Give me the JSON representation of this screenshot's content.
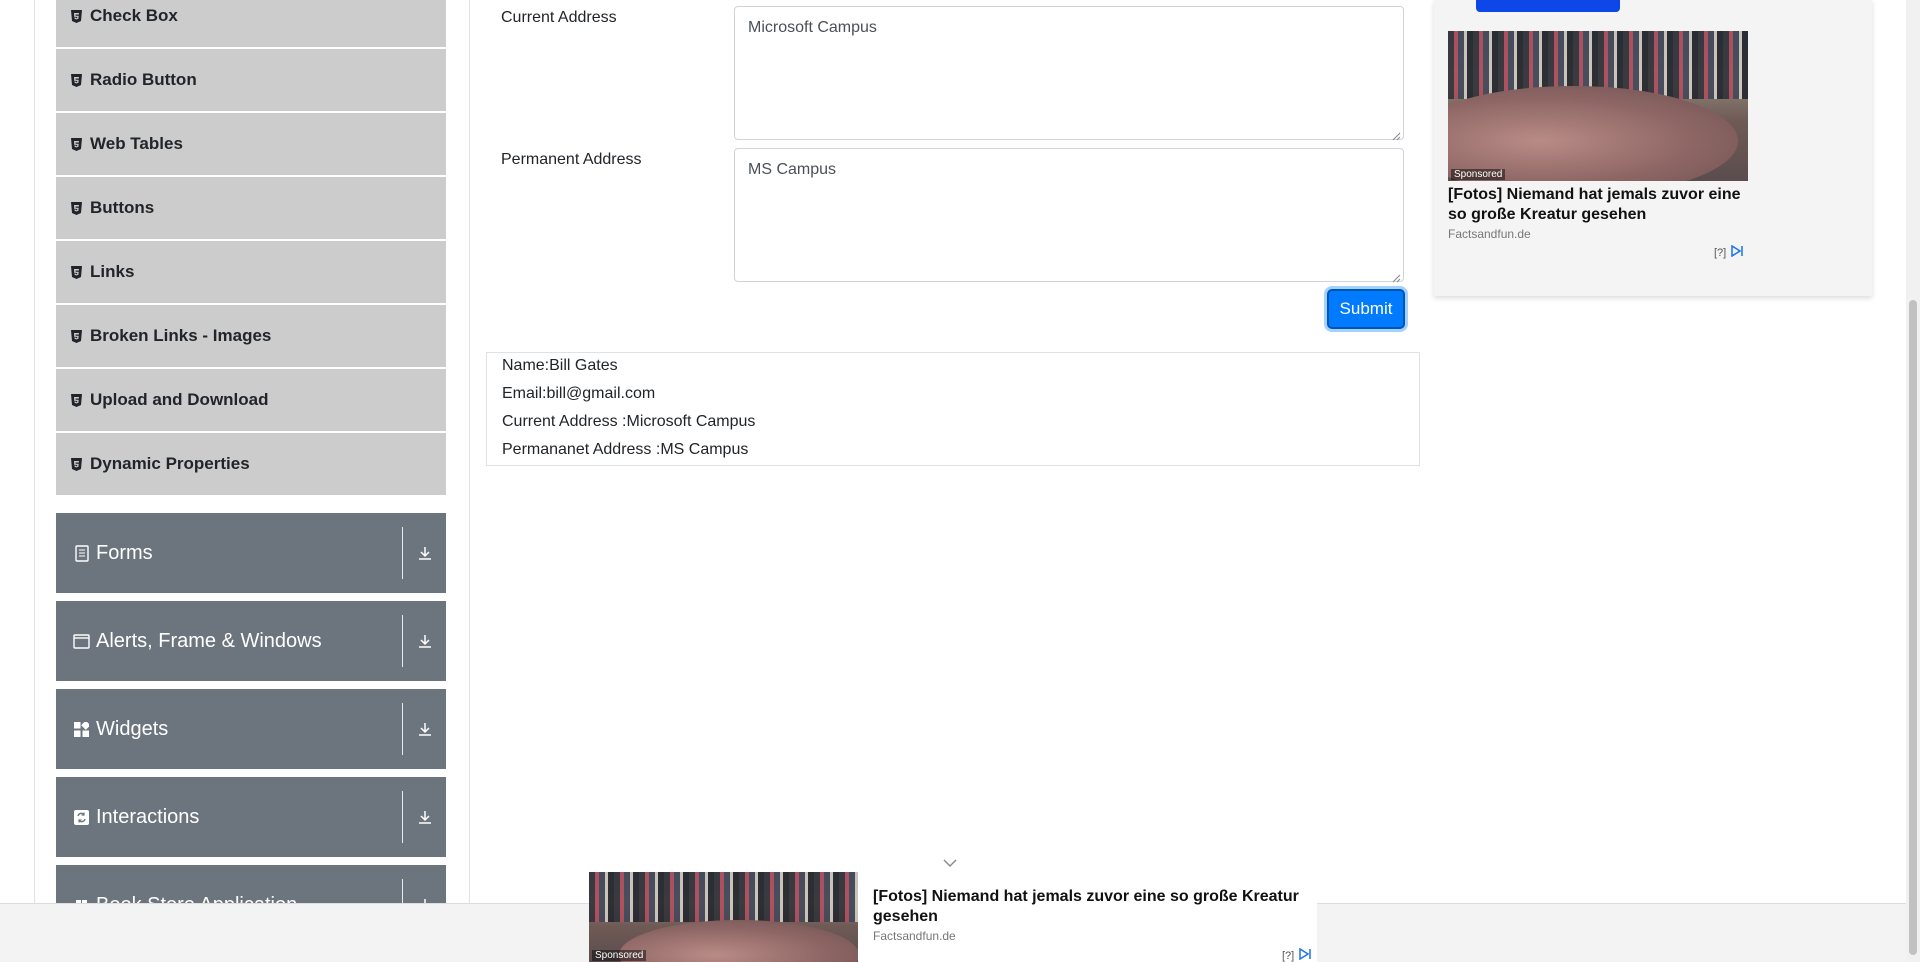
{
  "sidebar": {
    "elements_items": [
      {
        "label": "Check Box"
      },
      {
        "label": "Radio Button"
      },
      {
        "label": "Web Tables"
      },
      {
        "label": "Buttons"
      },
      {
        "label": "Links"
      },
      {
        "label": "Broken Links - Images"
      },
      {
        "label": "Upload and Download"
      },
      {
        "label": "Dynamic Properties"
      }
    ],
    "groups": [
      {
        "label": "Forms",
        "icon": "document-icon"
      },
      {
        "label": "Alerts, Frame & Windows",
        "icon": "window-icon"
      },
      {
        "label": "Widgets",
        "icon": "widgets-icon"
      },
      {
        "label": "Interactions",
        "icon": "interactions-icon"
      },
      {
        "label": "Book Store Application",
        "icon": "book-icon"
      }
    ]
  },
  "form": {
    "current_address_label": "Current Address",
    "current_address_value": "Microsoft Campus",
    "permanent_address_label": "Permanent Address",
    "permanent_address_value": "MS Campus",
    "submit_label": "Submit"
  },
  "output": {
    "name": "Name:Bill Gates",
    "email": "Email:bill@gmail.com",
    "current_address": "Current Address :Microsoft Campus",
    "permanent_address": "Permananet Address :MS Campus"
  },
  "ad_right": {
    "sponsored": "Sponsored",
    "title": "[Fotos] Niemand hat jemals zuvor eine so große Kreatur gesehen",
    "source": "Factsandfun.de",
    "info": "[?]"
  },
  "ad_bottom": {
    "sponsored": "Sponsored",
    "title": "[Fotos] Niemand hat jemals zuvor eine so große Kreatur gesehen",
    "source": "Factsandfun.de",
    "info": "[?]"
  },
  "colors": {
    "sidebar_item_bg": "#cccccc",
    "group_bg": "#6c757d",
    "submit_bg": "#007bff"
  }
}
